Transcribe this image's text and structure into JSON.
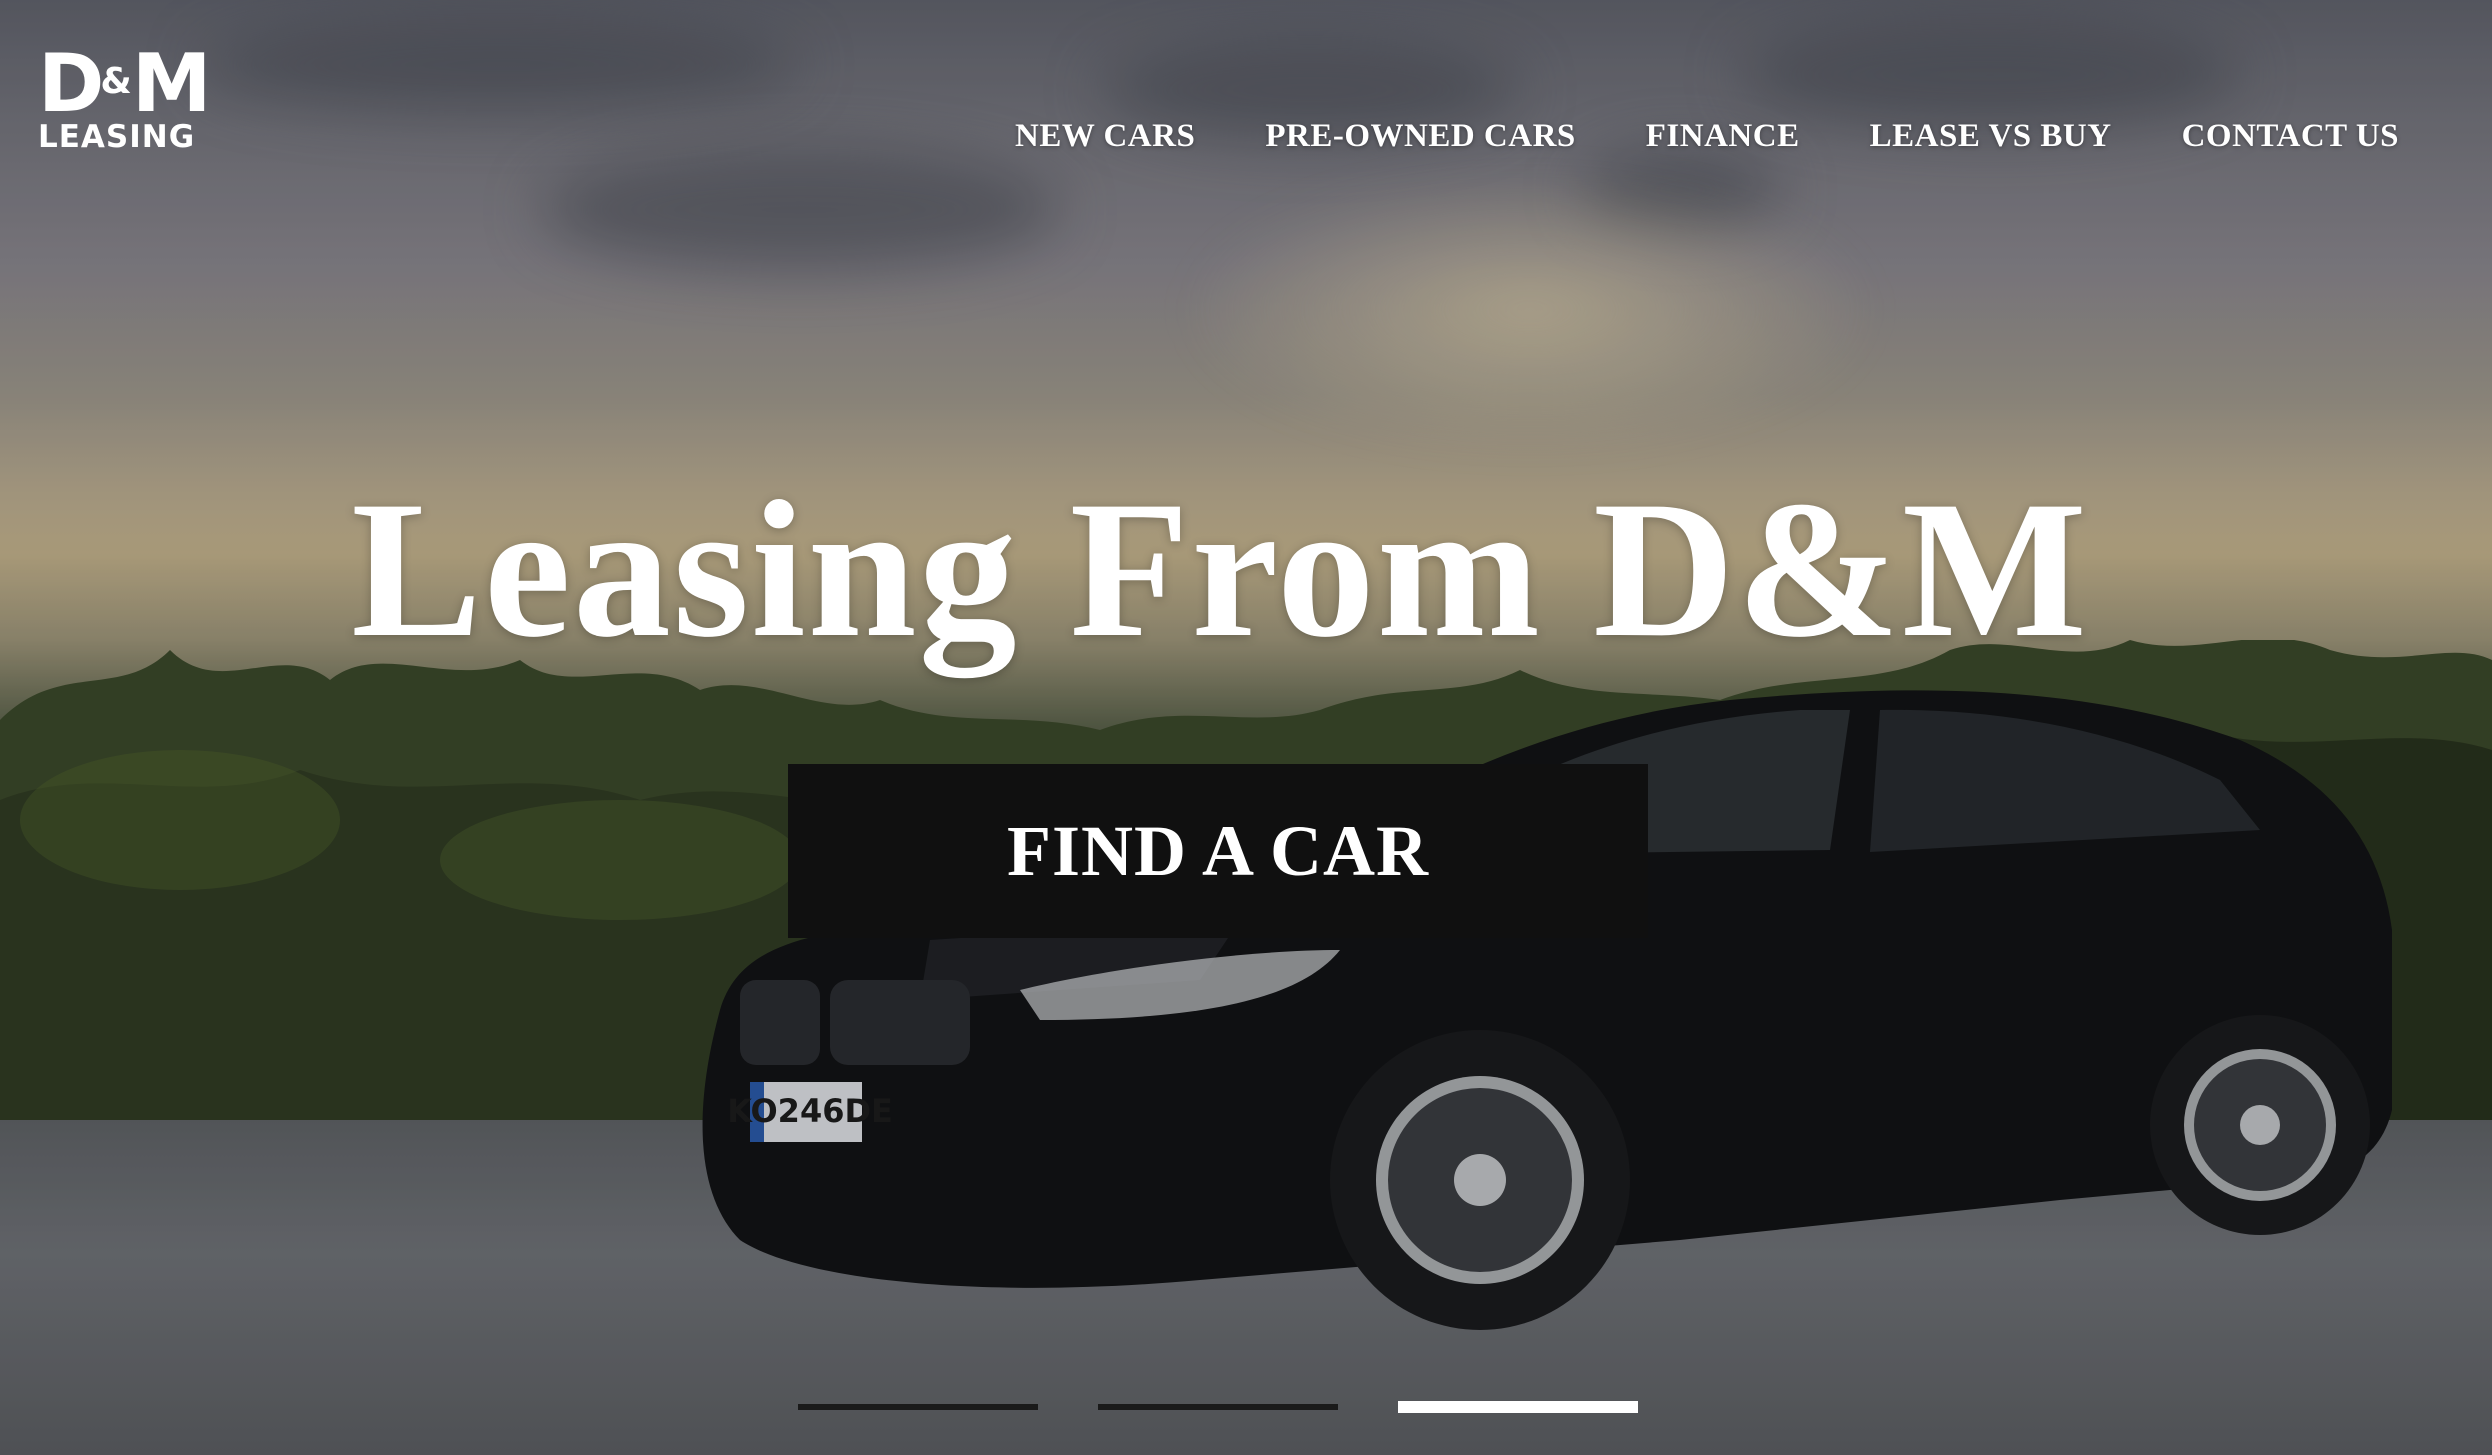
{
  "brand": {
    "logo_top": "D&M",
    "logo_top_left": "D",
    "logo_top_amp": "&",
    "logo_top_right": "M",
    "logo_bottom": "LEASING"
  },
  "nav": {
    "items": [
      {
        "label": "NEW CARS"
      },
      {
        "label": "PRE-OWNED CARS"
      },
      {
        "label": "FINANCE"
      },
      {
        "label": "LEASE VS BUY"
      },
      {
        "label": "CONTACT US"
      }
    ]
  },
  "hero": {
    "headline": "Leasing From D&M",
    "cta_label": "FIND A CAR",
    "license_plate": "KO246DE",
    "slide_count": 3,
    "active_slide": 3
  },
  "colors": {
    "text": "#ffffff",
    "cta_background": "#101010",
    "indicator_inactive": "#1a1a1a",
    "indicator_active": "#ffffff"
  }
}
